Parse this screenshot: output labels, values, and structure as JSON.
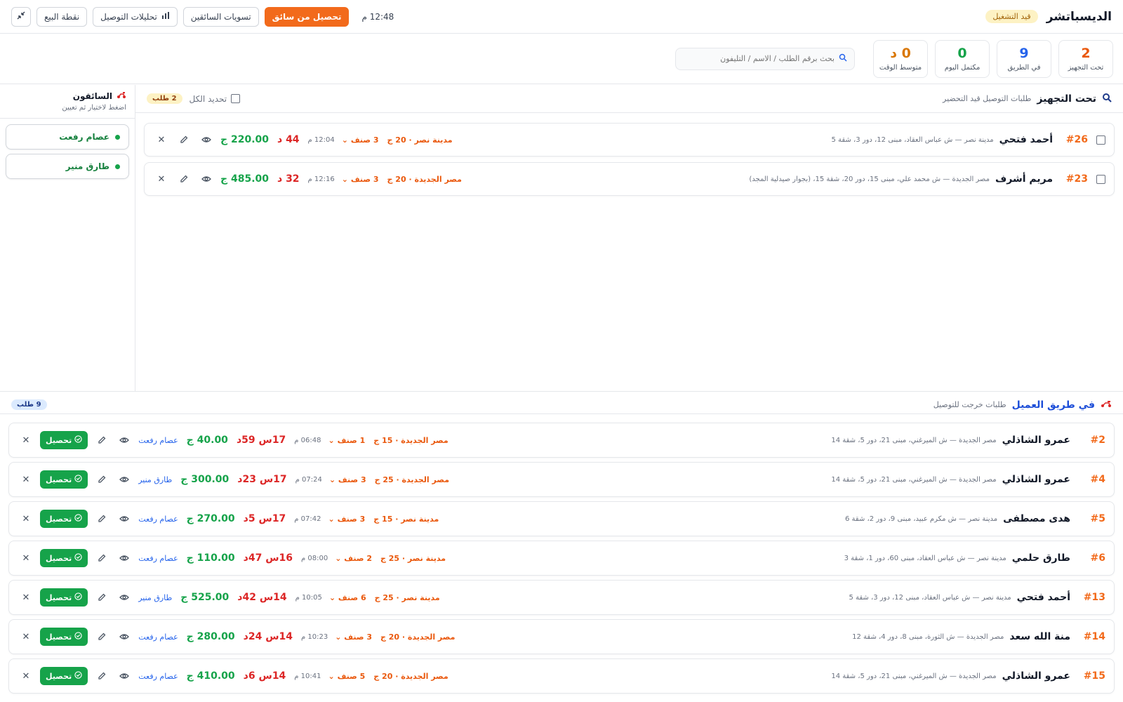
{
  "header": {
    "title": "الديسباتشر",
    "status": "قيد التشغيل",
    "clock": "12:48 م",
    "buttons": {
      "collect_from_driver": "تحصيل من سائق",
      "driver_settlements": "تسويات السائقين",
      "delivery_analytics": "تحليلات التوصيل",
      "pos": "نقطة البيع"
    }
  },
  "stats": [
    {
      "value": "2",
      "label": "تحت التجهيز",
      "color": "#ea580c"
    },
    {
      "value": "9",
      "label": "في الطريق",
      "color": "#2563eb"
    },
    {
      "value": "0",
      "label": "مكتمل اليوم",
      "color": "#16a34a"
    },
    {
      "value": "0 د",
      "label": "متوسط الوقت",
      "color": "#d97706"
    }
  ],
  "search": {
    "placeholder": "بحث برقم الطلب / الاسم / التليفون"
  },
  "preparing": {
    "title": "تحت التجهيز",
    "subtitle": "طلبات التوصيل قيد التحضير",
    "select_all": "تحديد الكل",
    "count": "2 طلب",
    "orders": [
      {
        "id": "#26",
        "name": "أحمد فتحي",
        "address": "مدينة نصر — ش عباس العقاد، مبنى 12، دور 3، شقة 5",
        "zone": "مدينة نصر · 20 ج",
        "items": "3 صنف",
        "time": "12:04 م",
        "elapsed": "44 د",
        "amount": "220.00 ج"
      },
      {
        "id": "#23",
        "name": "مريم أشرف",
        "address": "مصر الجديدة — ش محمد علي، مبنى 15، دور 20، شقة 15، (بجوار صيدلية المجد)",
        "zone": "مصر الجديدة · 20 ج",
        "items": "3 صنف",
        "time": "12:16 م",
        "elapsed": "32 د",
        "amount": "485.00 ج"
      }
    ]
  },
  "drivers": {
    "title": "السائقون",
    "subtitle": "اضغط لاختيار ثم تعيين",
    "list": [
      {
        "name": "عصام رفعت"
      },
      {
        "name": "طارق منير"
      }
    ]
  },
  "on_way": {
    "title": "في طريق العميل",
    "subtitle": "طلبات خرجت للتوصيل",
    "count": "9 طلب",
    "collect_label": "تحصيل",
    "orders": [
      {
        "id": "#2",
        "name": "عمرو الشاذلي",
        "address": "مصر الجديدة — ش الميرغني، مبنى 21، دور 5، شقة 14",
        "zone": "مصر الجديدة · 15 ج",
        "items": "1 صنف",
        "time": "06:48 م",
        "elapsed": "17س 59د",
        "amount": "40.00 ج",
        "driver": "عصام رفعت"
      },
      {
        "id": "#4",
        "name": "عمرو الشاذلي",
        "address": "مصر الجديدة — ش الميرغني، مبنى 21، دور 5، شقة 14",
        "zone": "مصر الجديدة · 25 ج",
        "items": "3 صنف",
        "time": "07:24 م",
        "elapsed": "17س 23د",
        "amount": "300.00 ج",
        "driver": "طارق منير"
      },
      {
        "id": "#5",
        "name": "هدى مصطفى",
        "address": "مدينة نصر — ش مكرم عبيد، مبنى 9، دور 2، شقة 6",
        "zone": "مدينة نصر · 15 ج",
        "items": "3 صنف",
        "time": "07:42 م",
        "elapsed": "17س 5د",
        "amount": "270.00 ج",
        "driver": "عصام رفعت"
      },
      {
        "id": "#6",
        "name": "طارق حلمي",
        "address": "مدينة نصر — ش عباس العقاد، مبنى 60، دور 1، شقة 3",
        "zone": "مدينة نصر · 25 ج",
        "items": "2 صنف",
        "time": "08:00 م",
        "elapsed": "16س 47د",
        "amount": "110.00 ج",
        "driver": "عصام رفعت"
      },
      {
        "id": "#13",
        "name": "أحمد فتحي",
        "address": "مدينة نصر — ش عباس العقاد، مبنى 12، دور 3، شقة 5",
        "zone": "مدينة نصر · 25 ج",
        "items": "6 صنف",
        "time": "10:05 م",
        "elapsed": "14س 42د",
        "amount": "525.00 ج",
        "driver": "طارق منير"
      },
      {
        "id": "#14",
        "name": "منة الله سعد",
        "address": "مصر الجديدة — ش الثورة، مبنى 8، دور 4، شقة 12",
        "zone": "مصر الجديدة · 20 ج",
        "items": "3 صنف",
        "time": "10:23 م",
        "elapsed": "14س 24د",
        "amount": "280.00 ج",
        "driver": "عصام رفعت"
      },
      {
        "id": "#15",
        "name": "عمرو الشاذلي",
        "address": "مصر الجديدة — ش الميرغني، مبنى 21، دور 5، شقة 14",
        "zone": "مصر الجديدة · 20 ج",
        "items": "5 صنف",
        "time": "10:41 م",
        "elapsed": "14س 6د",
        "amount": "410.00 ج",
        "driver": "عصام رفعت"
      }
    ]
  }
}
